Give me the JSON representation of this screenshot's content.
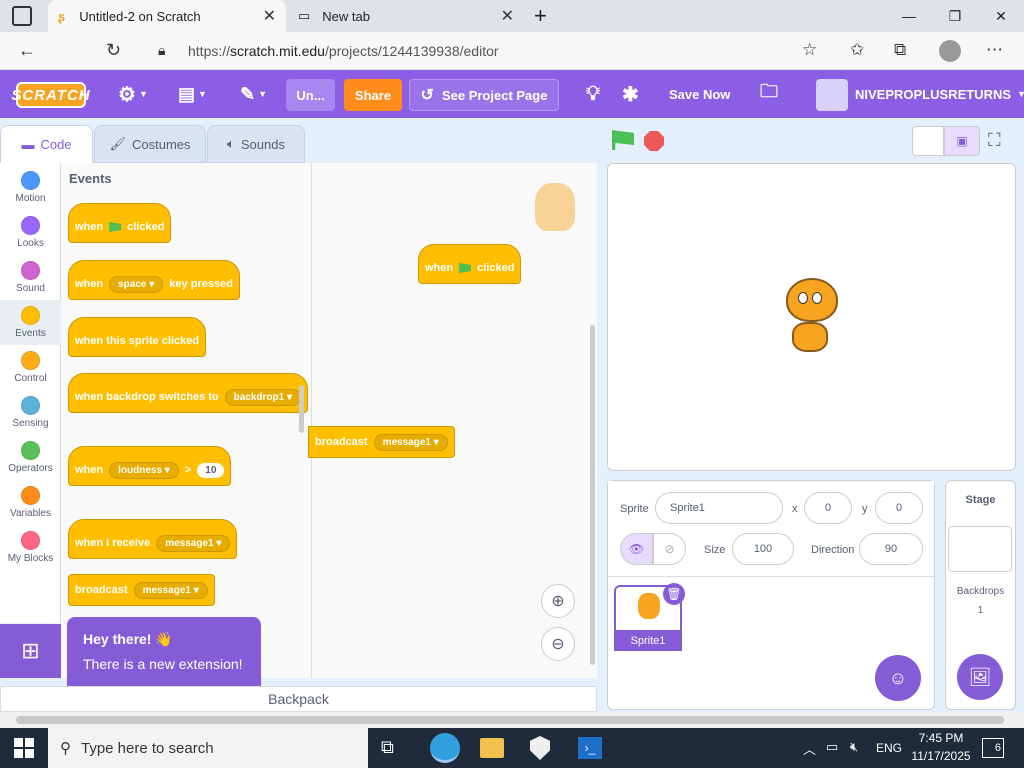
{
  "browser": {
    "tab1_title": "Untitled-2 on Scratch",
    "tab2_title": "New tab",
    "url_prefix": "https://",
    "url_domain": "scratch.mit.edu",
    "url_path": "/projects/1244139938/editor"
  },
  "menubar": {
    "logo": "SCRATCH",
    "project_title": "Un...",
    "share": "Share",
    "see_project_page": "See Project Page",
    "save_now": "Save Now",
    "username": "NIVEPROPLUSRETURNS"
  },
  "tabs": {
    "code": "Code",
    "costumes": "Costumes",
    "sounds": "Sounds"
  },
  "categories": [
    {
      "label": "Motion",
      "color": "#4c97ff"
    },
    {
      "label": "Looks",
      "color": "#9966ff"
    },
    {
      "label": "Sound",
      "color": "#cf63cf"
    },
    {
      "label": "Events",
      "color": "#ffbf00"
    },
    {
      "label": "Control",
      "color": "#ffab19"
    },
    {
      "label": "Sensing",
      "color": "#5cb1d6"
    },
    {
      "label": "Operators",
      "color": "#59c059"
    },
    {
      "label": "Variables",
      "color": "#ff8c1a"
    },
    {
      "label": "My Blocks",
      "color": "#ff6680"
    }
  ],
  "palette": {
    "heading": "Events",
    "b1_when": "when",
    "b1_clicked": "clicked",
    "b2_when": "when",
    "b2_key": "space",
    "b2_pressed": "key pressed",
    "b3": "when this sprite clicked",
    "b4_text": "when backdrop switches to",
    "b4_val": "backdrop1",
    "b5_when": "when",
    "b5_val": "loudness",
    "b5_op": ">",
    "b5_num": "10",
    "b6_text": "when I receive",
    "b6_val": "message1",
    "b7_text": "broadcast",
    "b7_val": "message1"
  },
  "workspace": {
    "hat_when": "when",
    "hat_clicked": "clicked",
    "broadcast": "broadcast",
    "broadcast_val": "message1"
  },
  "tooltip": {
    "title": "Hey there! 👋",
    "body": "There is a new extension!"
  },
  "backpack": "Backpack",
  "sprite": {
    "label": "Sprite",
    "name": "Sprite1",
    "x_label": "x",
    "x": "0",
    "y_label": "y",
    "y": "0",
    "size_label": "Size",
    "size": "100",
    "direction_label": "Direction",
    "direction": "90",
    "thumb_label": "Sprite1"
  },
  "stage_pane": {
    "title": "Stage",
    "backdrops_label": "Backdrops",
    "backdrops_count": "1"
  },
  "taskbar": {
    "search_placeholder": "Type here to search",
    "lang": "ENG",
    "time": "7:45 PM",
    "date": "11/17/2025",
    "notif_count": "6"
  }
}
